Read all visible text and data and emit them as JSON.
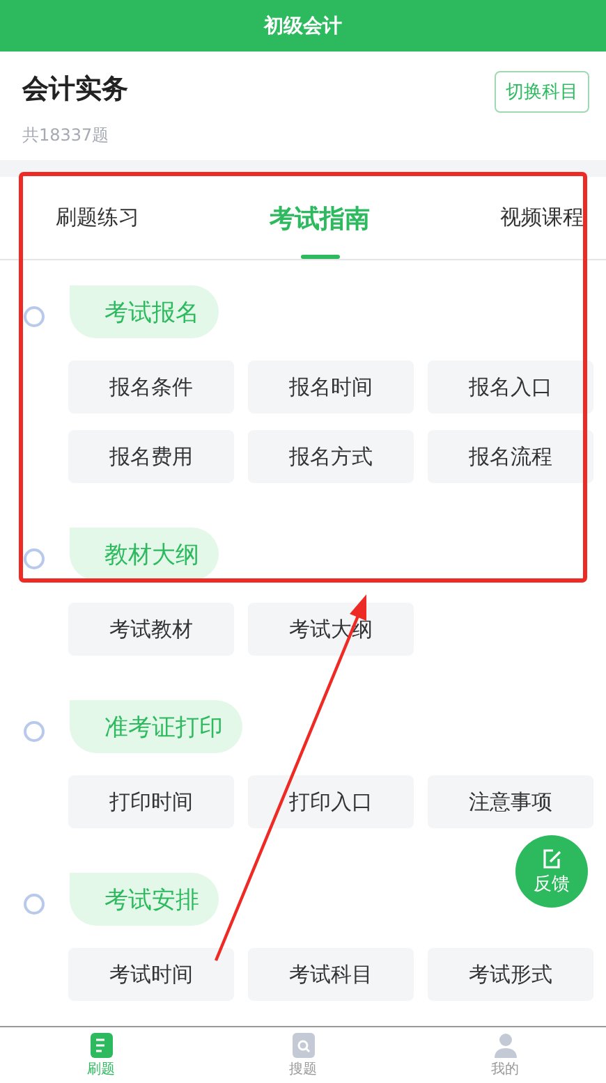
{
  "app_bar": {
    "title": "初级会计"
  },
  "subject": {
    "name": "会计实务",
    "count": "共18337题",
    "switch_button": "切换科目"
  },
  "tabs": [
    {
      "label": "刷题练习",
      "selected": false
    },
    {
      "label": "考试指南",
      "selected": true
    },
    {
      "label": "视频课程",
      "selected": false
    }
  ],
  "sections": [
    {
      "title": "考试报名",
      "items": [
        "报名条件",
        "报名时间",
        "报名入口",
        "报名费用",
        "报名方式",
        "报名流程"
      ]
    },
    {
      "title": "教材大纲",
      "items": [
        "考试教材",
        "考试大纲"
      ]
    },
    {
      "title": "准考证打印",
      "items": [
        "打印时间",
        "打印入口",
        "注意事项"
      ]
    },
    {
      "title": "考试安排",
      "items": [
        "考试时间",
        "考试科目",
        "考试形式"
      ]
    }
  ],
  "feedback_button": {
    "label": "反馈"
  },
  "bottom_nav": [
    {
      "label": "刷题",
      "kind": "practice",
      "selected": true
    },
    {
      "label": "搜题",
      "kind": "search",
      "selected": false
    },
    {
      "label": "我的",
      "kind": "profile",
      "selected": false
    }
  ]
}
